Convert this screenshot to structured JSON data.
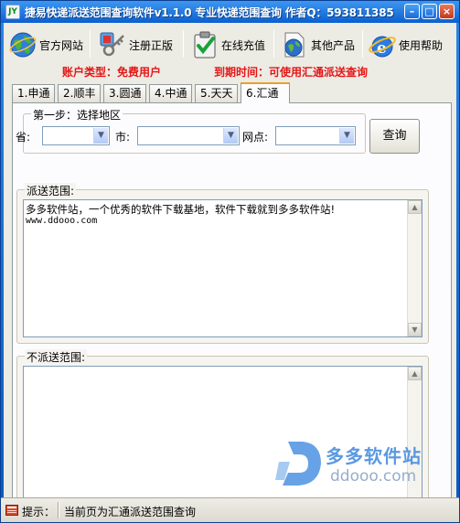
{
  "window": {
    "title": "捷易快递派送范围查询软件v1.1.0 专业快递范围查询 作者Q：593811385",
    "icon_text": "JY",
    "minimize_glyph": "–",
    "maximize_glyph": "□",
    "close_glyph": "×"
  },
  "toolbar": {
    "items": [
      {
        "label": "官方网站",
        "icon": "globe-icon"
      },
      {
        "label": "注册正版",
        "icon": "keys-icon"
      },
      {
        "label": "在线充值",
        "icon": "clipboard-check-icon"
      },
      {
        "label": "其他产品",
        "icon": "document-globe-icon"
      },
      {
        "label": "使用帮助",
        "icon": "ie-help-icon"
      }
    ]
  },
  "info": {
    "account_type": "账户类型：免费用户",
    "expire_time": "到期时间：可使用汇通派送查询"
  },
  "tabs": [
    {
      "label": "1.申通",
      "active": false
    },
    {
      "label": "2.顺丰",
      "active": false
    },
    {
      "label": "3.圆通",
      "active": false
    },
    {
      "label": "4.中通",
      "active": false
    },
    {
      "label": "5.天天",
      "active": false
    },
    {
      "label": "6.汇通",
      "active": true
    }
  ],
  "step1": {
    "legend": "第一步：选择地区",
    "province_label": "省:",
    "city_label": "市:",
    "outlet_label": "网点:",
    "province_value": "",
    "city_value": "",
    "outlet_value": "",
    "query_button": "查询"
  },
  "delivery": {
    "legend": "派送范围:",
    "text_line1": "多多软件站，一个优秀的软件下载基地，软件下载就到多多软件站!",
    "text_line2": "www.ddooo.com"
  },
  "no_delivery": {
    "legend": "不派送范围:",
    "text": ""
  },
  "status": {
    "label": "提示：",
    "message": "当前页为汇通派送范围查询"
  },
  "watermark": {
    "name": "多多软件站",
    "url": "ddooo.com"
  },
  "colors": {
    "title_bar": "#0c5fd0",
    "info_red": "#e41616",
    "active_tab_accent": "#e6a22a",
    "watermark_blue": "#4a8fe0"
  }
}
